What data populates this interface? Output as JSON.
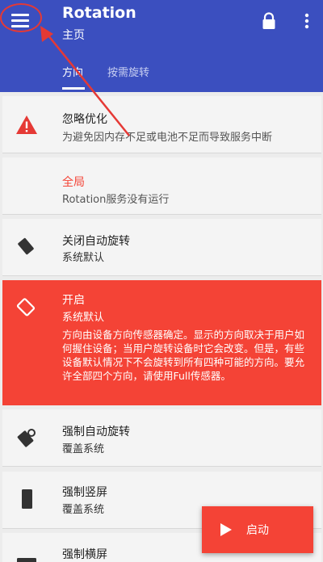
{
  "appbar": {
    "title": "Rotation",
    "subtitle": "主页",
    "tabs": [
      {
        "label": "方向"
      },
      {
        "label": "按需旋转"
      }
    ]
  },
  "cards": [
    {
      "title": "忽略优化",
      "subtitle": "为避免因内存不足或电池不足而导致服务中断",
      "icon": "warning-icon"
    },
    {
      "title": "全局",
      "subtitle": "Rotation服务没有运行"
    },
    {
      "title": "关闭自动旋转",
      "subtitle": "系统默认",
      "icon": "rotation-off-icon"
    },
    {
      "title": "开启",
      "subtitle": "系统默认",
      "description": "方向由设备方向传感器确定。显示的方向取决于用户如何握住设备；当用户旋转设备时它会改变。但是，有些设备默认情况下不会旋转到所有四种可能的方向。要允许全部四个方向，请使用Full传感器。",
      "icon": "rotation-on-icon"
    },
    {
      "title": "强制自动旋转",
      "subtitle": "覆盖系统",
      "icon": "force-rotation-icon"
    },
    {
      "title": "强制竖屏",
      "subtitle": "覆盖系统",
      "icon": "portrait-icon"
    },
    {
      "title": "强制横屏",
      "icon": "landscape-icon"
    }
  ],
  "fab": {
    "label": "启动",
    "icon": "play-icon"
  },
  "colors": {
    "primary": "#3b4fbf",
    "accent": "#f44336",
    "annotation": "#e53935"
  }
}
